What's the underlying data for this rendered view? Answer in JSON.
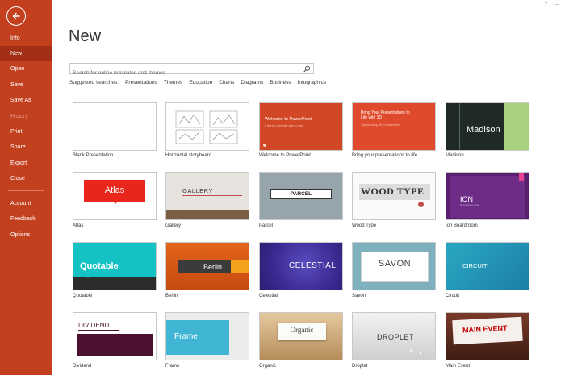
{
  "sidebar": {
    "items": [
      {
        "label": "Info"
      },
      {
        "label": "New"
      },
      {
        "label": "Open"
      },
      {
        "label": "Save"
      },
      {
        "label": "Save As"
      },
      {
        "label": "History"
      },
      {
        "label": "Print"
      },
      {
        "label": "Share"
      },
      {
        "label": "Export"
      },
      {
        "label": "Close"
      },
      {
        "label": "Account"
      },
      {
        "label": "Feedback"
      },
      {
        "label": "Options"
      }
    ]
  },
  "window": {
    "help": "?",
    "minimize": "–"
  },
  "main": {
    "title": "New",
    "search": {
      "placeholder": "Search for online templates and themes"
    },
    "suggested": {
      "label": "Suggested searches:",
      "links": [
        "Presentations",
        "Themes",
        "Education",
        "Charts",
        "Diagrams",
        "Business",
        "Infographics"
      ]
    },
    "templates": [
      {
        "label": "Blank Presentation",
        "text": ""
      },
      {
        "label": "Horizontal storyboard",
        "text": ""
      },
      {
        "label": "Welcome to PowerPoint",
        "text": "Welcome to PowerPoint",
        "sub": "5 tips for a simpler way to work"
      },
      {
        "label": "Bring your presentations to life...",
        "text": "Bring Your Presentations to Life with 3D",
        "sub": "Tips for using 3D in PowerPoint"
      },
      {
        "label": "Madison",
        "text": "Madison"
      },
      {
        "label": "Atlas",
        "text": "Atlas"
      },
      {
        "label": "Gallery",
        "text": "GALLERY"
      },
      {
        "label": "Parcel",
        "text": "PARCEL"
      },
      {
        "label": "Wood Type",
        "text": "WOOD TYPE"
      },
      {
        "label": "Ion Boardroom",
        "text": "ION",
        "sub": "BOARDROOM"
      },
      {
        "label": "Quotable",
        "text": "Quotable"
      },
      {
        "label": "Berlin",
        "text": "Berlin"
      },
      {
        "label": "Celestial",
        "text": "CELESTIAL"
      },
      {
        "label": "Savon",
        "text": "SAVON"
      },
      {
        "label": "Circuit",
        "text": "CIRCUIT"
      },
      {
        "label": "Dividend",
        "text": "DIVIDEND"
      },
      {
        "label": "Frame",
        "text": "Frame"
      },
      {
        "label": "Organic",
        "text": "Organic"
      },
      {
        "label": "Droplet",
        "text": "DROPLET"
      },
      {
        "label": "Main Event",
        "text": "MAIN EVENT"
      }
    ]
  },
  "colors": {
    "accent": "#c3401f",
    "active": "#a32f16"
  }
}
